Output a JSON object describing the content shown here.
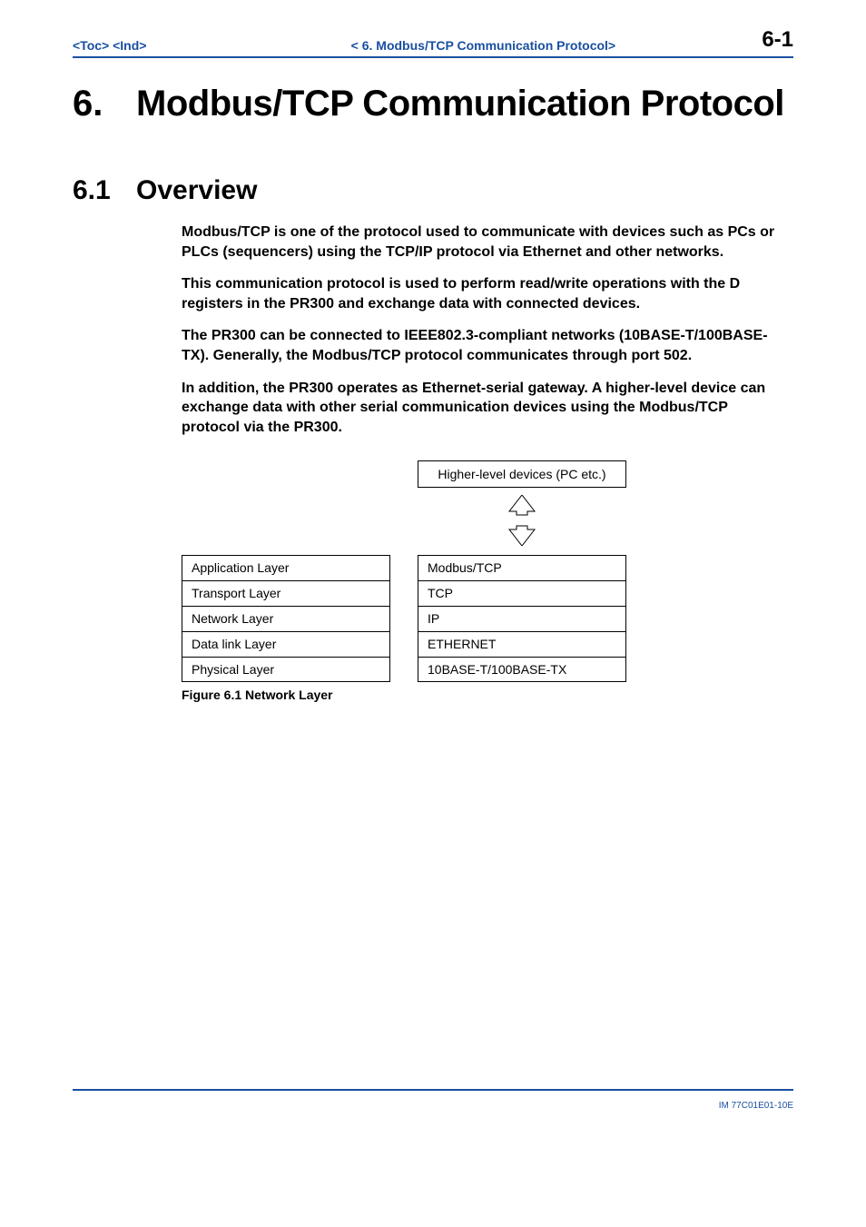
{
  "header": {
    "toc": "<Toc>",
    "ind": "<Ind>",
    "center": "< 6.  Modbus/TCP Communication Protocol>",
    "pagenum": "6-1"
  },
  "chapter": {
    "num": "6.",
    "title": "Modbus/TCP Communication Protocol"
  },
  "section": {
    "num": "6.1",
    "title": "Overview"
  },
  "paragraphs": {
    "p1": "Modbus/TCP is one of the protocol used to communicate with devices such as PCs or PLCs (sequencers) using the TCP/IP protocol via Ethernet and other networks.",
    "p2": "This communication protocol is used to perform read/write operations with the D registers in the PR300 and exchange data with connected devices.",
    "p3": "The PR300 can be connected to IEEE802.3-compliant networks (10BASE-T/100BASE-TX). Generally, the Modbus/TCP protocol communicates through port 502.",
    "p4": "In addition, the PR300 operates as Ethernet-serial gateway. A higher-level device can exchange data with other serial communication devices using the Modbus/TCP protocol via the PR300."
  },
  "diagram": {
    "top_box": "Higher-level devices (PC etc.)",
    "left_layers": {
      "l1": "Application Layer",
      "l2": "Transport Layer",
      "l3": "Network Layer",
      "l4": "Data link Layer",
      "l5": "Physical Layer"
    },
    "right_layers": {
      "r1": "Modbus/TCP",
      "r2": "TCP",
      "r3": "IP",
      "r4": "ETHERNET",
      "r5": "10BASE-T/100BASE-TX"
    },
    "caption": "Figure 6.1  Network Layer"
  },
  "footer": {
    "docid": "IM 77C01E01-10E"
  }
}
